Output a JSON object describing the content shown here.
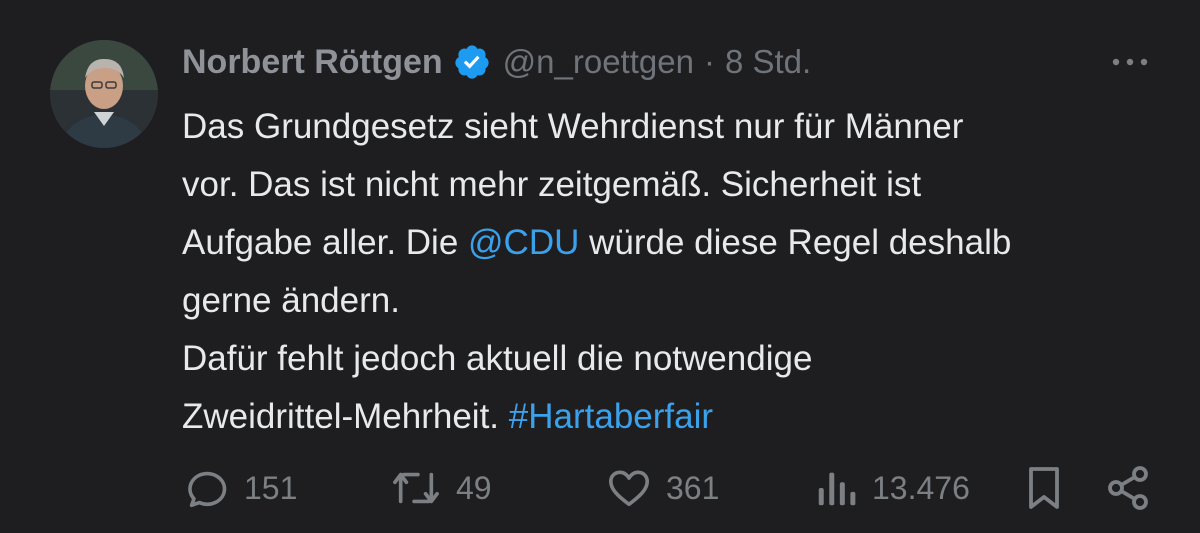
{
  "author": {
    "name": "Norbert Röttgen",
    "handle": "@n_roettgen",
    "separator": "·",
    "time": "8 Std."
  },
  "tweet": {
    "lines": [
      "Das Grundgesetz sieht Wehrdienst nur für Männer",
      "vor. Das ist nicht mehr zeitgemäß. Sicherheit ist"
    ],
    "line3_prefix": "Aufgabe aller. Die ",
    "mention": "@CDU",
    "line3_suffix": " würde diese Regel deshalb",
    "line4": "gerne ändern.",
    "line5": "Dafür fehlt jedoch aktuell die notwendige",
    "line6_prefix": "Zweidrittel-Mehrheit. ",
    "hashtag": "#Hartaberfair"
  },
  "actions": {
    "replies": "151",
    "retweets": "49",
    "likes": "361",
    "views": "13.476"
  },
  "icons": {
    "verified": "verified-badge-icon",
    "more": "more-icon",
    "reply": "reply-icon",
    "retweet": "retweet-icon",
    "like": "heart-icon",
    "views": "views-icon",
    "bookmark": "bookmark-icon",
    "share": "share-icon"
  },
  "colors": {
    "background": "#1e1e20",
    "text": "#e7e9ea",
    "secondary": "#6f747a",
    "link": "#3aa1ea",
    "verified": "#1d9bf0"
  }
}
